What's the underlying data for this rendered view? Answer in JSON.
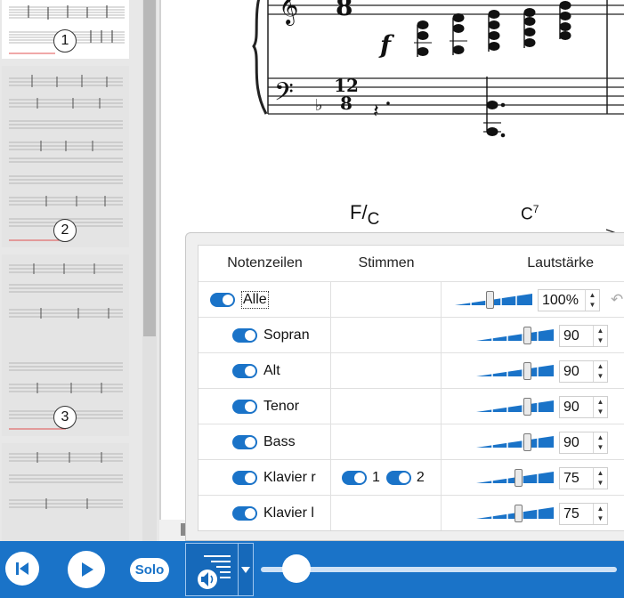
{
  "sidebar": {
    "pages": [
      {
        "number": "1"
      },
      {
        "number": "2"
      },
      {
        "number": "3"
      },
      {
        "number": ""
      }
    ]
  },
  "score": {
    "chord_1": "F",
    "chord_1_bass": "C",
    "chord_2": "C",
    "chord_2_sup": "7",
    "dynamic": "f",
    "time_sig_num": "12",
    "time_sig_den": "8",
    "upper_time_den": "8"
  },
  "mixer": {
    "header": {
      "staves": "Notenzeilen",
      "voices": "Stimmen",
      "volume": "Lautstärke"
    },
    "rows": [
      {
        "name": "Alle",
        "value": "100%",
        "volume_level": 0.45,
        "voices": []
      },
      {
        "name": "Sopran",
        "value": "90",
        "volume_level": 0.66,
        "voices": []
      },
      {
        "name": "Alt",
        "value": "90",
        "volume_level": 0.66,
        "voices": []
      },
      {
        "name": "Tenor",
        "value": "90",
        "volume_level": 0.66,
        "voices": []
      },
      {
        "name": "Bass",
        "value": "90",
        "volume_level": 0.66,
        "voices": []
      },
      {
        "name": "Klavier r",
        "value": "75",
        "volume_level": 0.55,
        "voices": [
          "1",
          "2"
        ]
      },
      {
        "name": "Klavier l",
        "value": "75",
        "volume_level": 0.55,
        "voices": []
      }
    ]
  },
  "transport": {
    "solo_label": "Solo",
    "progress": 0.1
  },
  "colors": {
    "accent": "#1a73c8"
  }
}
